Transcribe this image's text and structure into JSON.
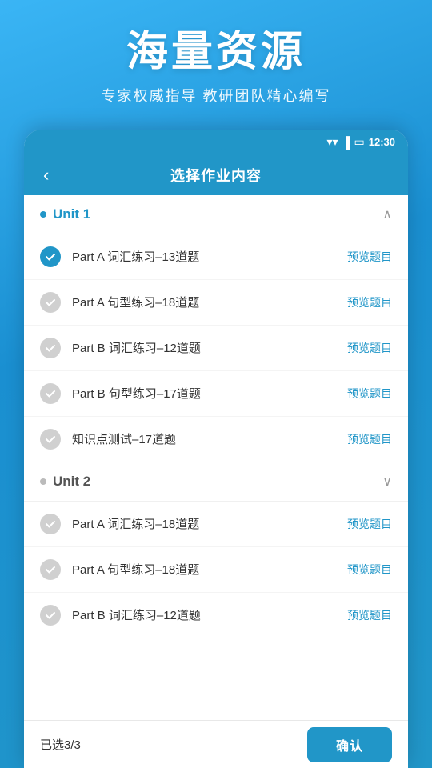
{
  "hero": {
    "title": "海量资源",
    "subtitle": "专家权威指导 教研团队精心编写"
  },
  "status_bar": {
    "time": "12:30"
  },
  "top_bar": {
    "back_label": "‹",
    "title": "选择作业内容"
  },
  "units": [
    {
      "id": "unit1",
      "label": "Unit 1",
      "expanded": true,
      "items": [
        {
          "id": "item1",
          "text": "Part A 词汇练习–13道题",
          "checked": true,
          "preview": "预览题目"
        },
        {
          "id": "item2",
          "text": "Part A 句型练习–18道题",
          "checked": false,
          "preview": "预览题目"
        },
        {
          "id": "item3",
          "text": "Part B 词汇练习–12道题",
          "checked": false,
          "preview": "预览题目"
        },
        {
          "id": "item4",
          "text": "Part B 句型练习–17道题",
          "checked": false,
          "preview": "预览题目"
        },
        {
          "id": "item5",
          "text": "知识点测试–17道题",
          "checked": false,
          "preview": "预览题目"
        }
      ]
    },
    {
      "id": "unit2",
      "label": "Unit 2",
      "expanded": false,
      "items": [
        {
          "id": "item6",
          "text": "Part A 词汇练习–18道题",
          "checked": false,
          "preview": "预览题目"
        },
        {
          "id": "item7",
          "text": "Part A 句型练习–18道题",
          "checked": false,
          "preview": "预览题目"
        },
        {
          "id": "item8",
          "text": "Part B 词汇练习–12道题",
          "checked": false,
          "preview": "预览题目"
        }
      ]
    }
  ],
  "bottom_bar": {
    "selected_count": "已选3/3",
    "confirm_label": "确认"
  }
}
